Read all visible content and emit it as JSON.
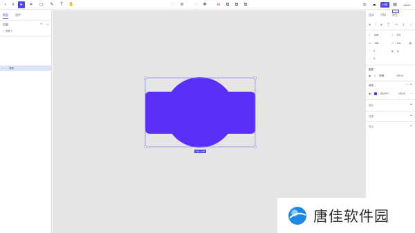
{
  "toolbar": {
    "share_label": "分享",
    "zoom": "100%"
  },
  "left_panel": {
    "tabs": [
      "图层",
      "组件"
    ],
    "pages_label": "页面",
    "page_item": "页面 1",
    "layer_name": "矩形"
  },
  "canvas": {
    "shape_fill": "#5A2FF7",
    "selection_color": "#4f46e5",
    "size_badge": "158 x 104"
  },
  "right_panel": {
    "tabs": [
      "设计",
      "代码",
      "原型"
    ],
    "x_label": "X",
    "x_value": "-828",
    "y_label": "Y",
    "y_value": "275",
    "w_label": "W",
    "w_value": "158",
    "h_label": "H",
    "h_value": "104",
    "rotation": "0 °",
    "radius": "0",
    "layer_section": "图层",
    "blend_mode": "穿透",
    "layer_opacity": "100 %",
    "fill_section": "填充",
    "fill_hex": "5A2FF7",
    "fill_opacity": "100 %",
    "stroke_section": "描边",
    "effects_section": "效果",
    "export_section": "导出"
  },
  "watermark": {
    "text": "唐佳软件园"
  }
}
